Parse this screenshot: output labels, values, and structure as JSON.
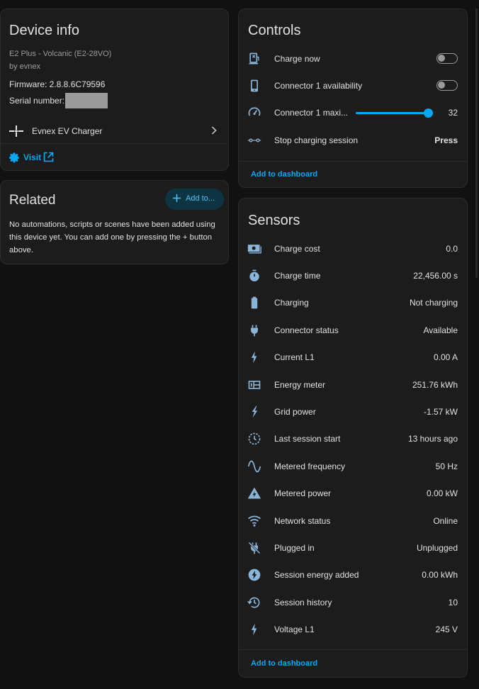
{
  "device_info": {
    "title": "Device info",
    "model": "E2 Plus - Volcanic (E2-28VO)",
    "manufacturer": "by evnex",
    "firmware_label": "Firmware: 2.8.8.6C79596",
    "serial_label": "Serial number:",
    "integration_label": "Evnex EV Charger",
    "visit_label": "Visit"
  },
  "related": {
    "title": "Related",
    "add_button": "Add to...",
    "message": "No automations, scripts or scenes have been added using this device yet. You can add one by pressing the + button above."
  },
  "controls": {
    "title": "Controls",
    "items": [
      {
        "label": "Charge now",
        "icon": "ev-station-icon",
        "control": "toggle",
        "state": "off"
      },
      {
        "label": "Connector 1 availability",
        "icon": "tablet-icon",
        "control": "toggle",
        "state": "off"
      },
      {
        "label": "Connector 1 maxi...",
        "icon": "gauge-icon",
        "control": "slider",
        "value": "32",
        "slider_fraction": 1.0
      },
      {
        "label": "Stop charging session",
        "icon": "button-dots-icon",
        "control": "button",
        "action_label": "Press"
      }
    ],
    "add_to_dashboard": "Add to dashboard"
  },
  "sensors": {
    "title": "Sensors",
    "items": [
      {
        "label": "Charge cost",
        "value": "0.0",
        "icon": "cash-icon"
      },
      {
        "label": "Charge time",
        "value": "22,456.00 s",
        "icon": "timer-icon"
      },
      {
        "label": "Charging",
        "value": "Not charging",
        "icon": "battery-icon"
      },
      {
        "label": "Connector status",
        "value": "Available",
        "icon": "plug-icon"
      },
      {
        "label": "Current L1",
        "value": "0.00 A",
        "icon": "flash-icon"
      },
      {
        "label": "Energy meter",
        "value": "251.76 kWh",
        "icon": "meter-icon"
      },
      {
        "label": "Grid power",
        "value": "-1.57 kW",
        "icon": "lightning-icon"
      },
      {
        "label": "Last session start",
        "value": "13 hours ago",
        "icon": "clock-outline-icon"
      },
      {
        "label": "Metered frequency",
        "value": "50 Hz",
        "icon": "sine-wave-icon"
      },
      {
        "label": "Metered power",
        "value": "0.00 kW",
        "icon": "triangle-flash-icon"
      },
      {
        "label": "Network status",
        "value": "Online",
        "icon": "wifi-icon"
      },
      {
        "label": "Plugged in",
        "value": "Unplugged",
        "icon": "plug-off-icon"
      },
      {
        "label": "Session energy added",
        "value": "0.00 kWh",
        "icon": "circle-flash-icon"
      },
      {
        "label": "Session history",
        "value": "10",
        "icon": "history-icon"
      },
      {
        "label": "Voltage L1",
        "value": "245 V",
        "icon": "flash-icon"
      }
    ],
    "add_to_dashboard": "Add to dashboard"
  },
  "colors": {
    "background": "#111111",
    "card": "#1c1c1c",
    "accent": "#03a9f4",
    "icon": "#8ab4d8",
    "text": "#e1e1e1",
    "muted": "#9e9e9e"
  }
}
